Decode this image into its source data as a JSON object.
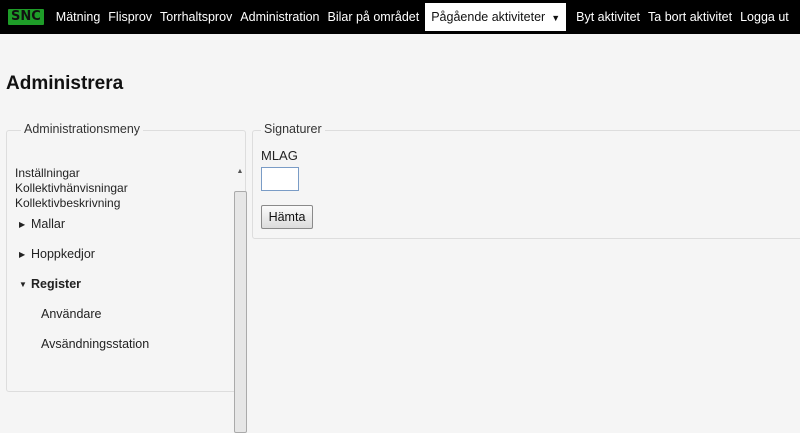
{
  "brand": {
    "logo_text": "SNC"
  },
  "nav": {
    "items": [
      {
        "label": "Mätning"
      },
      {
        "label": "Flisprov"
      },
      {
        "label": "Torrhaltsprov"
      },
      {
        "label": "Administration"
      },
      {
        "label": "Bilar på området"
      }
    ],
    "active_dropdown": {
      "label": "Pågående aktiviteter",
      "caret": "▼"
    },
    "right_items": [
      {
        "label": "Byt aktivitet"
      },
      {
        "label": "Ta bort aktivitet"
      },
      {
        "label": "Logga ut"
      }
    ]
  },
  "page": {
    "title": "Administrera"
  },
  "admin_menu": {
    "legend": "Administrationsmeny",
    "plain_items": [
      "Inställningar",
      "Kollektivhänvisningar",
      "Kollektivbeskrivning"
    ],
    "groups": [
      {
        "label": "Mallar",
        "expanded": false,
        "arrow": "▶"
      },
      {
        "label": "Hoppkedjor",
        "expanded": false,
        "arrow": "▶"
      },
      {
        "label": "Register",
        "expanded": true,
        "arrow": "▼"
      }
    ],
    "register_items": [
      "Användare",
      "Avsändningsstation"
    ],
    "scroll_up_glyph": "▲"
  },
  "signatures": {
    "legend": "Signaturer",
    "field_label": "MLAG",
    "field_value": "",
    "button_label": "Hämta"
  }
}
